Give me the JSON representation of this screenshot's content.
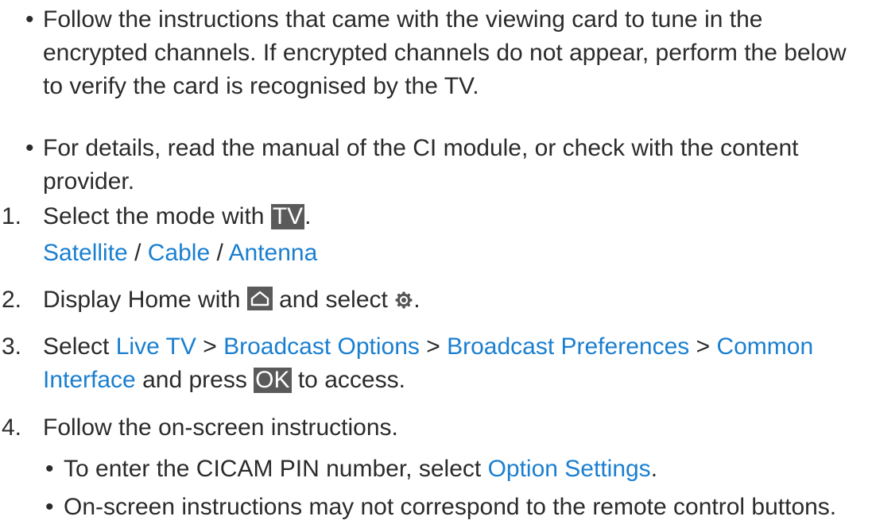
{
  "bullets_top": [
    "Follow the instructions that came with the viewing card to tune in the encrypted channels. If encrypted channels do not appear, perform the below to verify the card is recognised by the TV.",
    "For details, read the manual of the CI module, or check with the content provider."
  ],
  "bullet_char": "•",
  "steps": {
    "s1": {
      "num": "1.",
      "text_before": "Select the mode with ",
      "key": "TV",
      "text_after": ".",
      "modes": {
        "satellite": "Satellite",
        "sep1": " / ",
        "cable": "Cable",
        "sep2": " / ",
        "antenna": "Antenna"
      }
    },
    "s2": {
      "num": "2.",
      "text_before": "Display Home with ",
      "home_icon": "home-icon",
      "text_middle": " and select ",
      "settings_icon": "gear-icon",
      "text_after": "."
    },
    "s3": {
      "num": "3.",
      "text_before": "Select ",
      "live_tv": "Live TV",
      "sep1": " > ",
      "broadcast_options": "Broadcast Options",
      "sep2": " > ",
      "broadcast_preferences": "Broadcast Preferences",
      "sep3": " > ",
      "common": "Common",
      "interface": "Interface",
      "text_middle": " and press ",
      "key": "OK",
      "text_after": " to access."
    },
    "s4": {
      "num": "4.",
      "text": "Follow the on-screen instructions."
    }
  },
  "sub_bullets": {
    "b1": {
      "text_before": "To enter the CICAM PIN number, select ",
      "link": "Option Settings",
      "text_after": "."
    },
    "b2": {
      "text": "On-screen instructions may not correspond to the remote control buttons."
    }
  },
  "colors": {
    "link": "#1a7fd0",
    "text": "#2b2b2b",
    "key_bg": "#5a5a5a"
  }
}
